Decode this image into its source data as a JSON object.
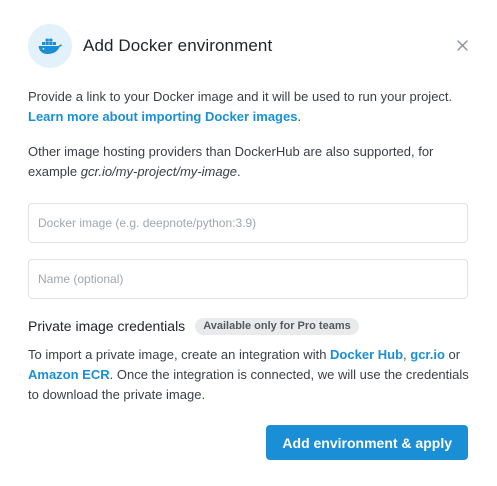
{
  "dialog": {
    "title": "Add Docker environment",
    "logo_icon": "docker-whale-icon",
    "close_icon": "close-icon",
    "intro": {
      "text_before": "Provide a link to your Docker image and it will be used to run your project. ",
      "link": "Learn more about importing Docker images",
      "text_after": "."
    },
    "hosting": {
      "text_before": "Other image hosting providers than DockerHub are also supported, for example ",
      "example": "gcr.io/my-project/my-image",
      "text_after": "."
    },
    "image_input": {
      "placeholder": "Docker image (e.g. deepnote/python:3.9)",
      "value": ""
    },
    "name_input": {
      "placeholder": "Name (optional)",
      "value": ""
    },
    "credentials": {
      "title": "Private image credentials",
      "badge": "Available only for Pro teams",
      "text_1": "To import a private image, create an integration with ",
      "link_docker_hub": "Docker Hub",
      "text_2": ", ",
      "link_gcr": "gcr.io",
      "text_3": " or ",
      "link_ecr": "Amazon ECR",
      "text_4": ". Once the integration is connected, we will use the credentials to download the private image."
    },
    "submit_label": "Add environment & apply"
  },
  "colors": {
    "accent": "#1b8fd6",
    "logo_bg": "#e3f1fa",
    "badge_bg": "#e8eaec"
  }
}
